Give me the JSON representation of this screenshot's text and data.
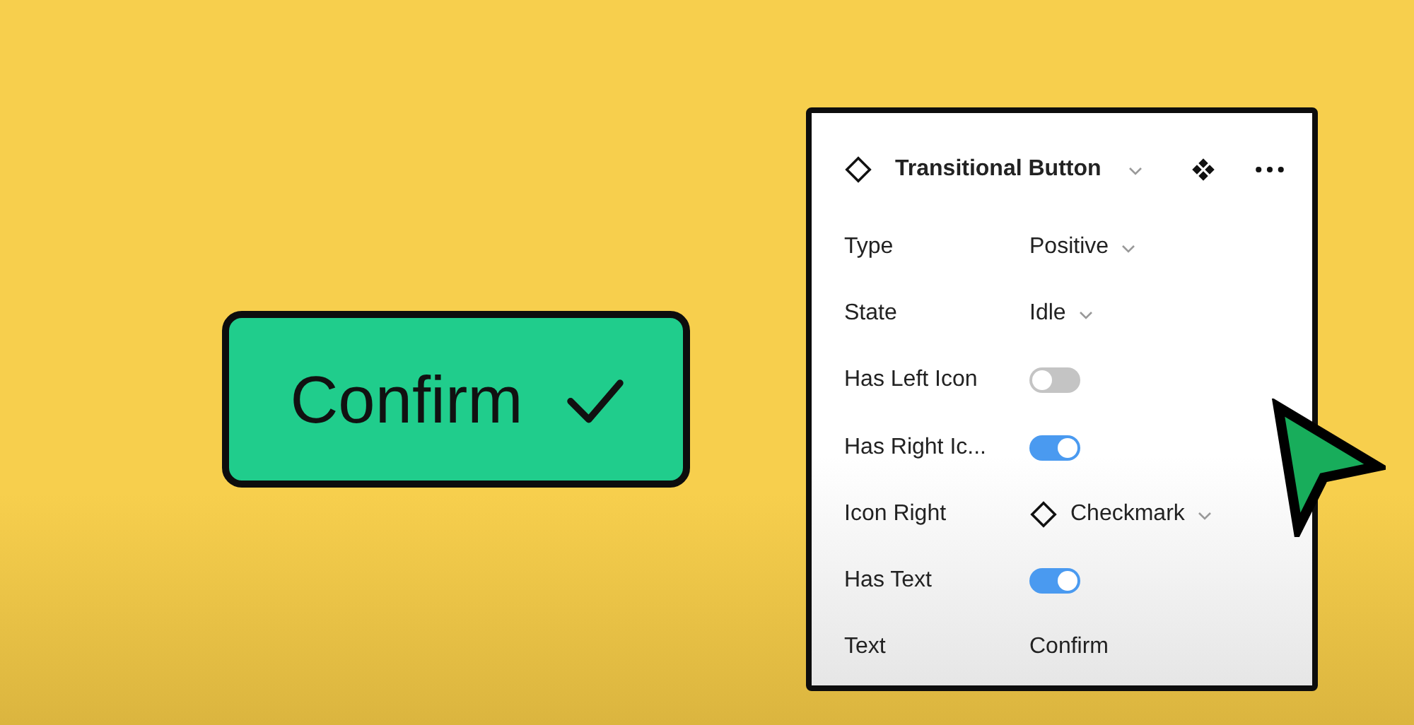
{
  "preview_button": {
    "label": "Confirm",
    "has_icon": true
  },
  "panel": {
    "title": "Transitional Button",
    "properties": [
      {
        "kind": "dropdown",
        "label": "Type",
        "value": "Positive"
      },
      {
        "kind": "dropdown",
        "label": "State",
        "value": "Idle"
      },
      {
        "kind": "toggle",
        "label": "Has Left Icon",
        "on": false
      },
      {
        "kind": "toggle",
        "label": "Has Right Ic...",
        "on": true
      },
      {
        "kind": "instance",
        "label": "Icon Right",
        "value": "Checkmark"
      },
      {
        "kind": "toggle",
        "label": "Has Text",
        "on": true
      },
      {
        "kind": "text",
        "label": "Text",
        "value": "Confirm"
      }
    ]
  }
}
